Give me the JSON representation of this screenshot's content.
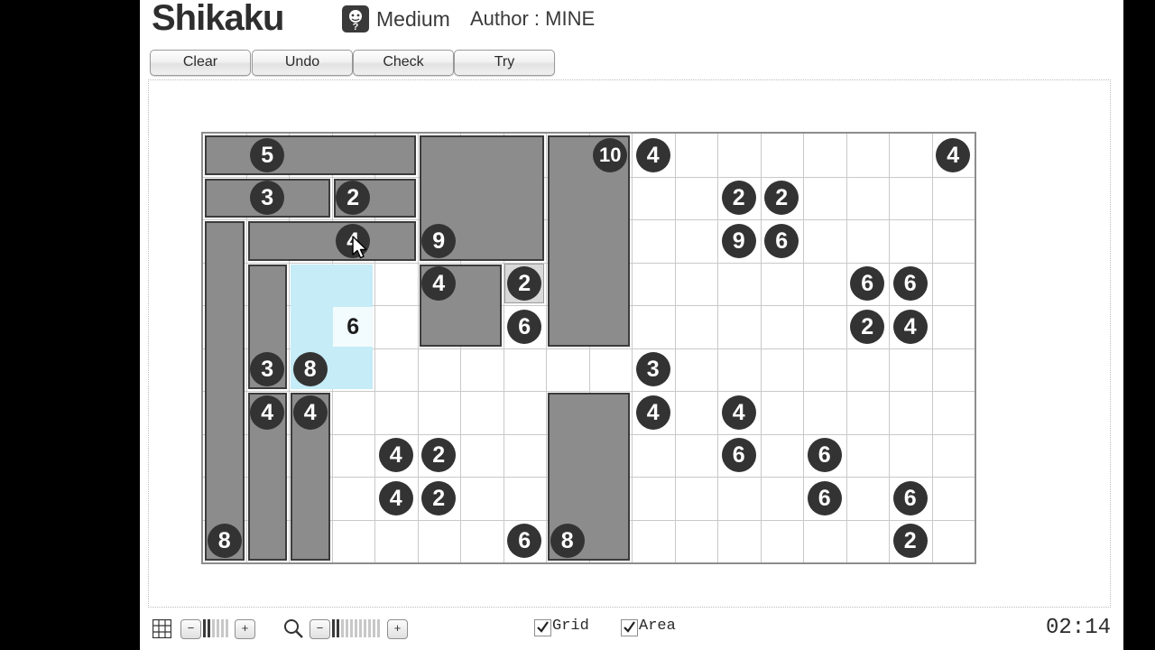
{
  "header": {
    "title": "Shikaku",
    "difficulty_icon": "puzzle-difficulty-icon",
    "difficulty": "Medium",
    "author": "Author : MINE"
  },
  "toolbar_top": {
    "clear": "Clear",
    "undo": "Undo",
    "check": "Check",
    "try": "Try"
  },
  "board": {
    "columns": 18,
    "rows": 10,
    "cell_size": 47.5,
    "colors": {
      "region_fill": "#8c8c8c",
      "region_border": "#3c3c3c",
      "selection": "#c5ecf7",
      "clue_bg": "#333333",
      "clue_text": "#ffffff",
      "grid_line": "#c9c9c9",
      "board_border": "#8d8d8d"
    },
    "clues": [
      {
        "row": 0,
        "col": 1,
        "value": "5"
      },
      {
        "row": 0,
        "col": 9,
        "value": "10"
      },
      {
        "row": 0,
        "col": 10,
        "value": "4"
      },
      {
        "row": 0,
        "col": 17,
        "value": "4"
      },
      {
        "row": 1,
        "col": 1,
        "value": "3"
      },
      {
        "row": 1,
        "col": 3,
        "value": "2"
      },
      {
        "row": 1,
        "col": 12,
        "value": "2"
      },
      {
        "row": 1,
        "col": 13,
        "value": "2"
      },
      {
        "row": 2,
        "col": 3,
        "value": "4"
      },
      {
        "row": 2,
        "col": 5,
        "value": "9"
      },
      {
        "row": 2,
        "col": 12,
        "value": "9"
      },
      {
        "row": 2,
        "col": 13,
        "value": "6"
      },
      {
        "row": 3,
        "col": 5,
        "value": "4"
      },
      {
        "row": 3,
        "col": 7,
        "value": "2"
      },
      {
        "row": 3,
        "col": 15,
        "value": "6"
      },
      {
        "row": 3,
        "col": 16,
        "value": "6"
      },
      {
        "row": 4,
        "col": 3,
        "value": "6"
      },
      {
        "row": 4,
        "col": 7,
        "value": "6"
      },
      {
        "row": 4,
        "col": 15,
        "value": "2"
      },
      {
        "row": 4,
        "col": 16,
        "value": "4"
      },
      {
        "row": 5,
        "col": 1,
        "value": "3"
      },
      {
        "row": 5,
        "col": 2,
        "value": "8"
      },
      {
        "row": 5,
        "col": 10,
        "value": "3"
      },
      {
        "row": 6,
        "col": 1,
        "value": "4"
      },
      {
        "row": 6,
        "col": 2,
        "value": "4"
      },
      {
        "row": 6,
        "col": 10,
        "value": "4"
      },
      {
        "row": 6,
        "col": 12,
        "value": "4"
      },
      {
        "row": 7,
        "col": 4,
        "value": "4"
      },
      {
        "row": 7,
        "col": 5,
        "value": "2"
      },
      {
        "row": 7,
        "col": 12,
        "value": "6"
      },
      {
        "row": 7,
        "col": 14,
        "value": "6"
      },
      {
        "row": 8,
        "col": 4,
        "value": "4"
      },
      {
        "row": 8,
        "col": 5,
        "value": "2"
      },
      {
        "row": 8,
        "col": 14,
        "value": "6"
      },
      {
        "row": 8,
        "col": 16,
        "value": "6"
      },
      {
        "row": 9,
        "col": 0,
        "value": "8"
      },
      {
        "row": 9,
        "col": 7,
        "value": "6"
      },
      {
        "row": 9,
        "col": 8,
        "value": "8"
      },
      {
        "row": 9,
        "col": 16,
        "value": "2"
      }
    ],
    "regions": [
      {
        "row": 0,
        "col": 0,
        "w": 5,
        "h": 1
      },
      {
        "row": 1,
        "col": 0,
        "w": 3,
        "h": 1
      },
      {
        "row": 1,
        "col": 3,
        "w": 2,
        "h": 1
      },
      {
        "row": 2,
        "col": 0,
        "w": 1,
        "h": 8
      },
      {
        "row": 2,
        "col": 1,
        "w": 4,
        "h": 1
      },
      {
        "row": 0,
        "col": 5,
        "w": 3,
        "h": 3
      },
      {
        "row": 0,
        "col": 8,
        "w": 2,
        "h": 5
      },
      {
        "row": 3,
        "col": 1,
        "w": 1,
        "h": 3
      },
      {
        "row": 3,
        "col": 5,
        "w": 2,
        "h": 2
      },
      {
        "row": 6,
        "col": 1,
        "w": 1,
        "h": 4
      },
      {
        "row": 6,
        "col": 2,
        "w": 1,
        "h": 4
      },
      {
        "row": 6,
        "col": 8,
        "w": 2,
        "h": 4
      }
    ],
    "selection": {
      "row": 3,
      "col": 2,
      "w": 2,
      "h": 3
    },
    "selected_clue": {
      "row": 4,
      "col": 3,
      "value": "6"
    },
    "boxed_clue": {
      "row": 3,
      "col": 7,
      "value": "2"
    }
  },
  "toolbar_bottom": {
    "grid_icon": "grid-size-icon",
    "search_icon": "zoom-magnifier-icon",
    "minus": "−",
    "plus": "+",
    "grid_checkbox_label": "Grid",
    "grid_checked": true,
    "area_checkbox_label": "Area",
    "area_checked": true,
    "timer": "02:14"
  }
}
